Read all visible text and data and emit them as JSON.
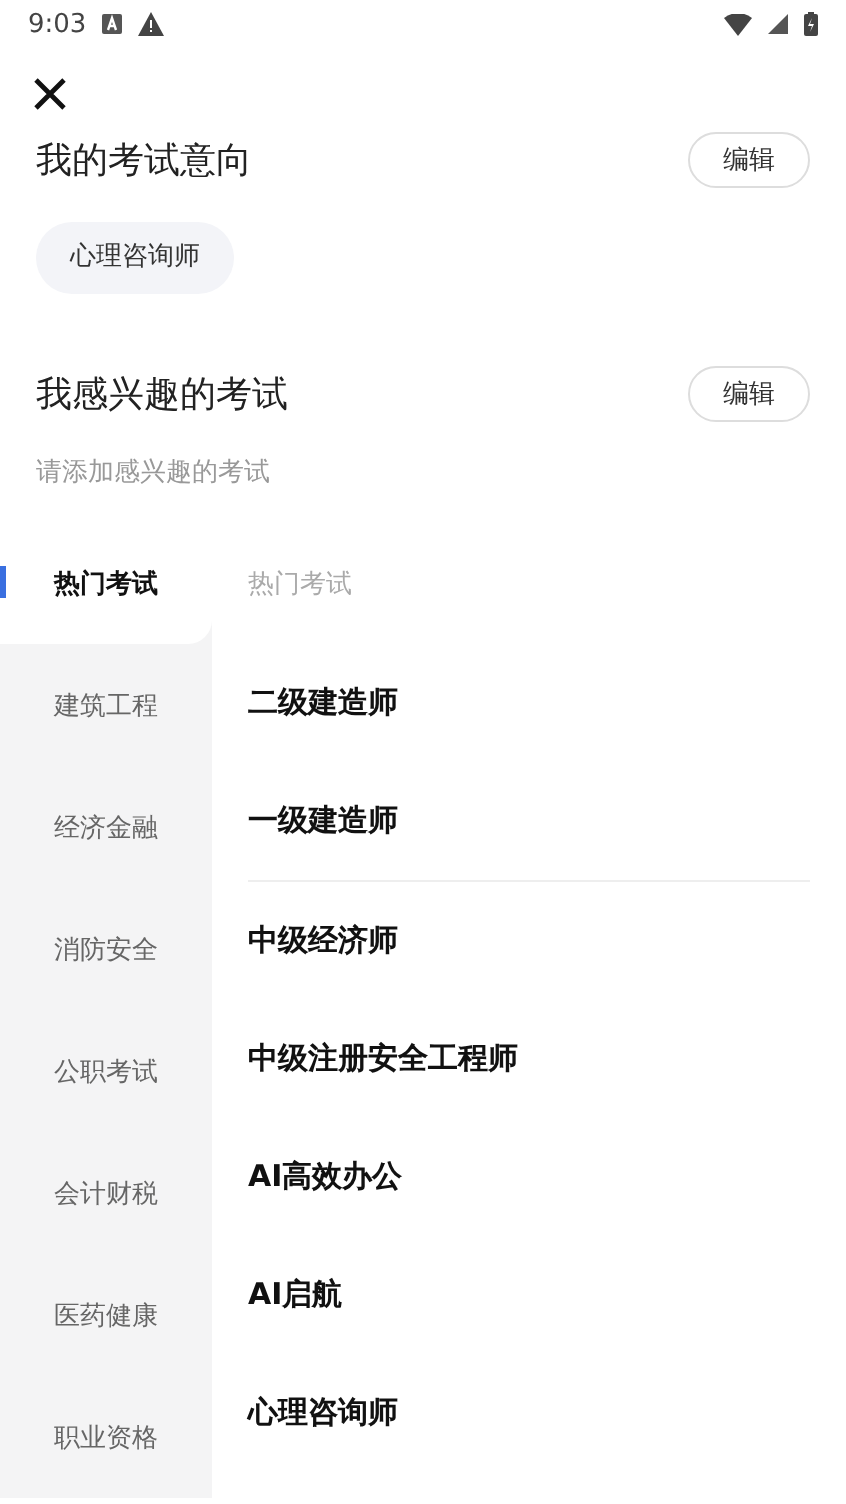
{
  "status_bar": {
    "time": "9:03"
  },
  "intent": {
    "title": "我的考试意向",
    "edit_button": "编辑",
    "chips": [
      "心理咨询师"
    ]
  },
  "interest": {
    "title": "我感兴趣的考试",
    "edit_button": "编辑",
    "hint": "请添加感兴趣的考试"
  },
  "categories": [
    {
      "label": "热门考试",
      "selected": true
    },
    {
      "label": "建筑工程",
      "selected": false
    },
    {
      "label": "经济金融",
      "selected": false
    },
    {
      "label": "消防安全",
      "selected": false
    },
    {
      "label": "公职考试",
      "selected": false
    },
    {
      "label": "会计财税",
      "selected": false
    },
    {
      "label": "医药健康",
      "selected": false
    },
    {
      "label": "职业资格",
      "selected": false
    }
  ],
  "exam_list": {
    "heading": "热门考试",
    "items": [
      {
        "label": "二级建造师",
        "divider_after": false
      },
      {
        "label": "一级建造师",
        "divider_after": true
      },
      {
        "label": "中级经济师",
        "divider_after": false
      },
      {
        "label": "中级注册安全工程师",
        "divider_after": false
      },
      {
        "label": "AI高效办公",
        "divider_after": false
      },
      {
        "label": "AI启航",
        "divider_after": false
      },
      {
        "label": "心理咨询师",
        "divider_after": false
      }
    ]
  }
}
